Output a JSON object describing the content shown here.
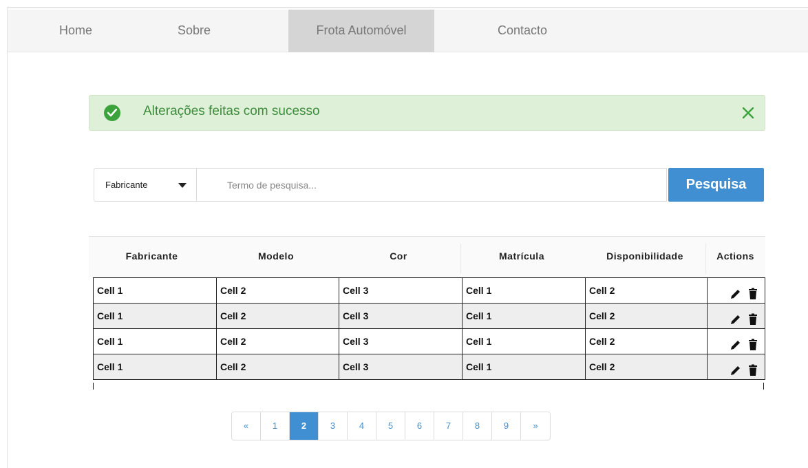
{
  "nav": {
    "items": [
      {
        "label": "Home"
      },
      {
        "label": "Sobre"
      },
      {
        "label": "Frota Automóvel"
      },
      {
        "label": "Contacto"
      }
    ],
    "active": "Frota Automóvel"
  },
  "alert": {
    "message": "Alterações feitas com sucesso",
    "type": "success",
    "color": "#dff0d8"
  },
  "search": {
    "field_selected": "Fabricante",
    "placeholder": "Termo de pesquisa...",
    "button_label": "Pesquisa",
    "button_color": "#3f8fd2"
  },
  "table": {
    "columns": [
      "Fabricante",
      "Modelo",
      "Cor",
      "Matrícula",
      "Disponibilidade",
      "Actions"
    ],
    "rows": [
      [
        "Cell 1",
        "Cell 2",
        "Cell 3",
        "Cell 1",
        "Cell 2"
      ],
      [
        "Cell 1",
        "Cell 2",
        "Cell 3",
        "Cell 1",
        "Cell 2"
      ],
      [
        "Cell 1",
        "Cell 2",
        "Cell 3",
        "Cell 1",
        "Cell 2"
      ],
      [
        "Cell 1",
        "Cell 2",
        "Cell 3",
        "Cell 1",
        "Cell 2"
      ]
    ],
    "row_actions": [
      "edit-icon",
      "delete-icon"
    ]
  },
  "pagination": {
    "prev": "«",
    "next": "»",
    "pages": [
      "1",
      "2",
      "3",
      "4",
      "5",
      "6",
      "7",
      "8",
      "9"
    ],
    "active_page": "2"
  }
}
